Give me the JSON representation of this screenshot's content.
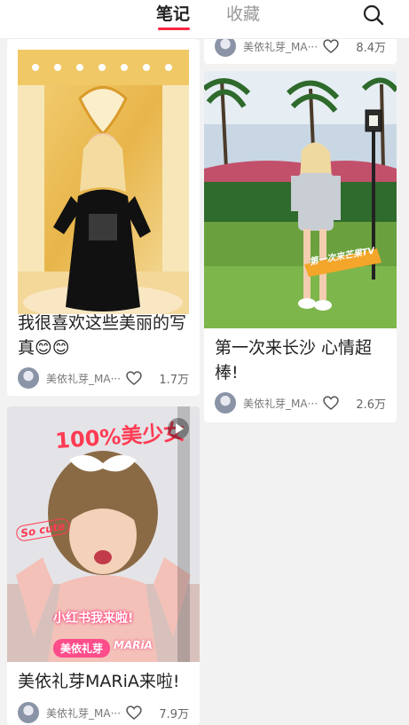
{
  "header": {
    "tabs": [
      {
        "label": "笔记",
        "active": true
      },
      {
        "label": "收藏",
        "active": false
      }
    ],
    "search_icon": "search-icon",
    "accent_color": "#ff2442"
  },
  "feed": {
    "cards": [
      {
        "title": "",
        "author": "美依礼芽_MA···",
        "likes": "8.4万"
      },
      {
        "title": "我很喜欢这些美丽的写真😊😊",
        "author": "美依礼芽_MA···",
        "likes": "1.7万",
        "image": "carousel-photo"
      },
      {
        "title": "第一次来长沙 心情超棒!",
        "author": "美依礼芽_MA···",
        "likes": "2.6万",
        "image": "park-photo",
        "image_text": "第一次来芒果TV"
      },
      {
        "title": "美依礼芽MARiA来啦!",
        "author": "美依礼芽_MA···",
        "likes": "7.9万",
        "image": "video-cover",
        "image_text": {
          "top": "100%美少女",
          "side": "So cute",
          "banner": "小红书我来啦!",
          "name_tag": "美依礼芽",
          "name_en": "MARiA"
        },
        "is_video": true
      }
    ]
  }
}
